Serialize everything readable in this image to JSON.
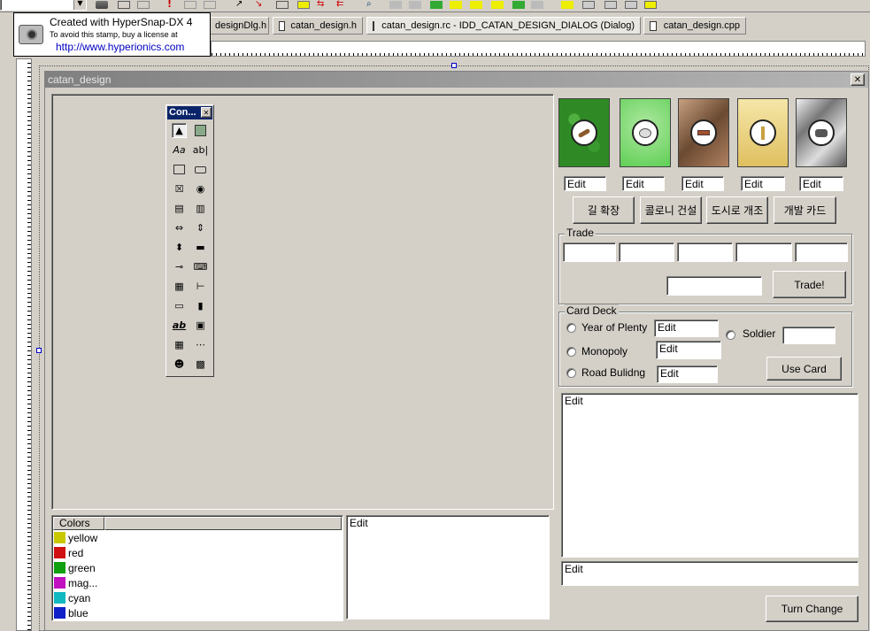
{
  "stamp": {
    "line1": "Created with HyperSnap-DX 4",
    "line2": "To avoid this stamp, buy a license at",
    "line3": "http://www.hyperionics.com"
  },
  "tabs": [
    {
      "label": "designDlg.h"
    },
    {
      "label": "catan_design.h"
    },
    {
      "label": "catan_design.rc - IDD_CATAN_DESIGN_DIALOG (Dialog)"
    },
    {
      "label": "catan_design.cpp"
    }
  ],
  "dialog": {
    "title": "catan_design",
    "close_label": "✕"
  },
  "controls_palette": {
    "title": "Con...",
    "close_label": "✕"
  },
  "resources": [
    {
      "edit": "Edit",
      "color": "#2f8a25"
    },
    {
      "edit": "Edit",
      "color": "#5fcf55"
    },
    {
      "edit": "Edit",
      "color": "#9a7352"
    },
    {
      "edit": "Edit",
      "color": "#e8cf7a"
    },
    {
      "edit": "Edit",
      "color": "#b8b8b8"
    }
  ],
  "action_buttons": [
    "길 확장",
    "콜로니 건설",
    "도시로 개조",
    "개발 카드"
  ],
  "trade": {
    "label": "Trade",
    "button": "Trade!"
  },
  "card_deck": {
    "label": "Card Deck",
    "options": [
      {
        "label": "Year of Plenty",
        "edit": "Edit"
      },
      {
        "label": "Monopoly",
        "edit": "Edit"
      },
      {
        "label": "Road Bulidng",
        "edit": "Edit"
      }
    ],
    "soldier_label": "Soldier",
    "use_button": "Use Card"
  },
  "log_edit": "Edit",
  "input_edit": "Edit",
  "turn_button": "Turn Change",
  "colors_list": {
    "header": "Colors",
    "items": [
      {
        "label": "yellow",
        "color": "#c8c800"
      },
      {
        "label": "red",
        "color": "#d01010"
      },
      {
        "label": "green",
        "color": "#10a010"
      },
      {
        "label": "mag...",
        "color": "#c010c0"
      },
      {
        "label": "cyan",
        "color": "#10b8c0"
      },
      {
        "label": "blue",
        "color": "#1020c8"
      }
    ]
  },
  "bottom_edit": "Edit"
}
